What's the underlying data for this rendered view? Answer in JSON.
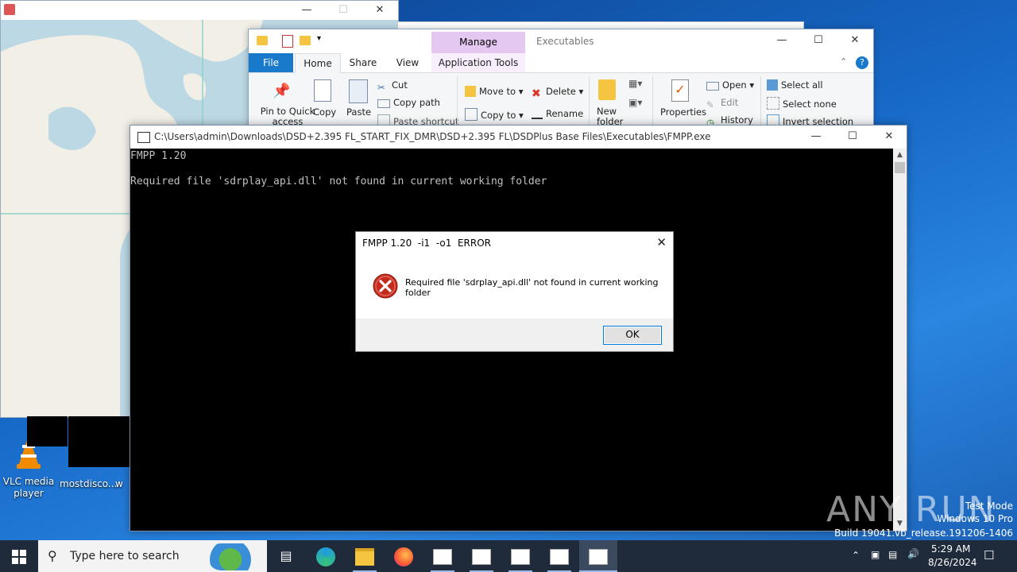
{
  "desktop": {
    "icons": [
      {
        "label": "VLC media player"
      },
      {
        "label": "mostdisco..."
      },
      {
        "label": "w"
      }
    ]
  },
  "explorer": {
    "title": "Executables",
    "context_tab": "Manage",
    "tabs": {
      "file": "File",
      "home": "Home",
      "share": "Share",
      "view": "View",
      "app_tools": "Application Tools"
    },
    "ribbon": {
      "pin": "Pin to Quick access",
      "copy": "Copy",
      "paste": "Paste",
      "cut": "Cut",
      "copy_path": "Copy path",
      "paste_shortcut": "Paste shortcut",
      "move_to": "Move to",
      "copy_to": "Copy to",
      "delete": "Delete",
      "rename": "Rename",
      "new_folder": "New folder",
      "properties": "Properties",
      "open": "Open",
      "edit": "Edit",
      "history": "History",
      "select_all": "Select all",
      "select_none": "Select none",
      "invert_selection": "Invert selection"
    }
  },
  "console": {
    "title": "C:\\Users\\admin\\Downloads\\DSD+2.395 FL_START_FIX_DMR\\DSD+2.395 FL\\DSDPlus Base Files\\Executables\\FMPP.exe",
    "line1": "FMPP 1.20",
    "line2": "Required file 'sdrplay_api.dll' not found in current working folder"
  },
  "dialog": {
    "title": "FMPP 1.20  -i1  -o1  ERROR",
    "message": "Required file 'sdrplay_api.dll' not found in current working folder",
    "ok": "OK"
  },
  "taskbar": {
    "search_placeholder": "Type here to search",
    "time": "5:29 AM",
    "date": "8/26/2024"
  },
  "watermark": {
    "line1": "Test Mode",
    "line2": "Windows 10 Pro",
    "line3": "Build 19041.vb_release.191206-1406",
    "brand": "ANY RUN"
  }
}
